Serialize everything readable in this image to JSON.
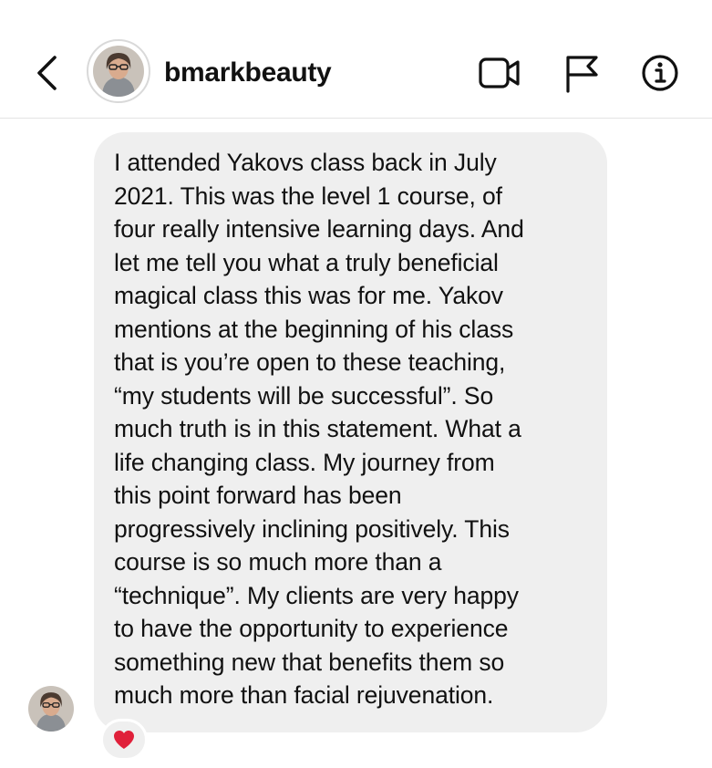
{
  "header": {
    "username": "bmarkbeauty",
    "icons": {
      "back": "chevron-left-icon",
      "video": "video-camera-icon",
      "flag": "flag-icon",
      "info": "info-icon"
    }
  },
  "message": {
    "text": "I attended Yakovs class back in July\n2021. This was the level 1 course, of\nfour really intensive learning days. And\nlet me tell you what a truly beneficial\nmagical class this was for me. Yakov\nmentions at the beginning of his class\nthat is you’re open to these teaching,\n“my students will be successful”. So\nmuch truth is in this statement. What a\nlife changing class. My journey from\nthis point forward has been\nprogressively inclining positively. This\ncourse is so much more than a\n“technique”.  My clients are very happy\nto have the opportunity to experience\nsomething new that benefits them so\nmuch more than facial rejuvenation.",
    "reaction": "heart-icon"
  },
  "colors": {
    "bubble": "#efefef",
    "text": "#111111",
    "heart": "#e0203a",
    "divider": "#e3e3e3"
  }
}
